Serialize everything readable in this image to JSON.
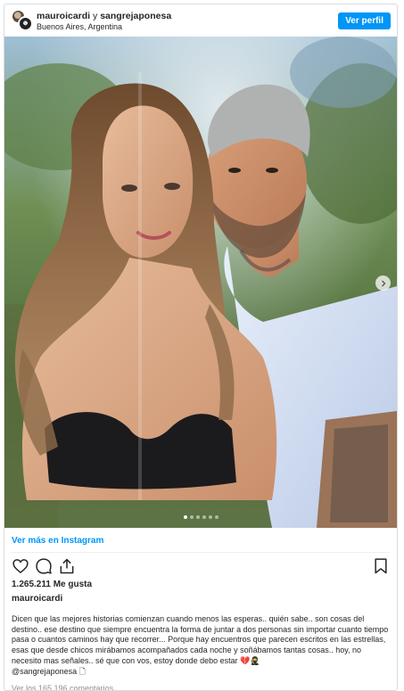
{
  "header": {
    "user1": "mauroicardi",
    "conjunction": "y",
    "user2": "sangrejaponesa",
    "location": "Buenos Aires, Argentina",
    "profile_button": "Ver perfil"
  },
  "carousel": {
    "slide_count": 6,
    "active_index": 0
  },
  "icons": [
    "heart-icon",
    "comment-icon",
    "share-icon",
    "bookmark-icon",
    "chevron-right-icon"
  ],
  "post": {
    "view_more": "Ver más en Instagram",
    "likes": "1.265.211 Me gusta",
    "author": "mauroicardi",
    "caption": "Dicen que las mejores historias comienzan cuando menos las esperas.. quién sabe.. son cosas del destino.. ese destino que siempre encuentra la forma de juntar a dos personas sin importar cuanto tiempo pasa o cuantos caminos hay que recorrer... Porque hay encuentros que parecen escritos en las estrellas, esas que desde chicos mirábamos acompañados cada noche y soñábamos tantas cosas.. hoy, no necesito mas señales.. sé que con vos, estoy donde debo estar 💔🥷",
    "mention": "@sangrejaponesa 🗋",
    "comments": "Ver los 165.196 comentarios"
  },
  "colors": {
    "accent": "#0095f6",
    "text": "#262626",
    "muted": "#8e8e8e",
    "border": "#dbdbdb"
  }
}
